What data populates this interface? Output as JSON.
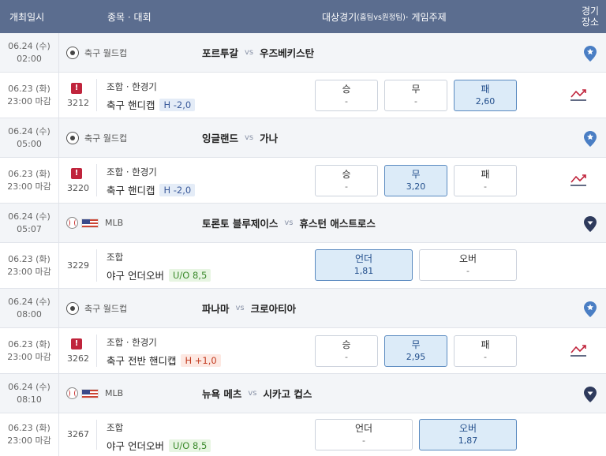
{
  "header": {
    "date": "개최일시",
    "game": "종목 · 대회",
    "match_main": "대상경기",
    "match_sub": "(홈팀vs원정팀)",
    "match_tail": " · 게임주제",
    "place_1": "경기",
    "place_2": "장소"
  },
  "vs": "vs",
  "colors": {
    "header_bg": "#5b6d8f",
    "selected": "#dcebf8",
    "warning": "#c0243c",
    "pin_blue": "#4a7ec4",
    "pin_dark": "#2e3a5c"
  },
  "games": [
    {
      "date": "06.24 (수)",
      "time": "02:00",
      "league": "축구 월드컵",
      "sport_icon": "soccer-ball-icon",
      "home": "포르투갈",
      "away": "우즈베키스탄",
      "pin": "blue"
    },
    {
      "date": "06.24 (수)",
      "time": "05:00",
      "league": "축구 월드컵",
      "sport_icon": "soccer-ball-icon",
      "home": "잉글랜드",
      "away": "가나",
      "pin": "blue"
    },
    {
      "date": "06.24 (수)",
      "time": "05:07",
      "league": "MLB",
      "sport_icon": "baseball-icon",
      "home": "토론토 블루제이스",
      "away": "휴스턴 애스트로스",
      "pin": "dark"
    },
    {
      "date": "06.24 (수)",
      "time": "08:00",
      "league": "축구 월드컵",
      "sport_icon": "soccer-ball-icon",
      "home": "파나마",
      "away": "크로아티아",
      "pin": "blue"
    },
    {
      "date": "06.24 (수)",
      "time": "08:10",
      "league": "MLB",
      "sport_icon": "baseball-icon",
      "home": "뉴욕 메츠",
      "away": "시카고 컵스",
      "pin": "dark"
    }
  ],
  "bets": [
    {
      "date": "06.23 (화)",
      "deadline": "23:00 마감",
      "warn": "!",
      "number": "3212",
      "type": "조합 · 한경기",
      "name": "축구 핸디캡",
      "handicap": "H -2,0",
      "odds": [
        {
          "label": "승",
          "value": "-"
        },
        {
          "label": "무",
          "value": "-"
        },
        {
          "label": "패",
          "value": "2,60"
        }
      ]
    },
    {
      "date": "06.23 (화)",
      "deadline": "23:00 마감",
      "warn": "!",
      "number": "3220",
      "type": "조합 · 한경기",
      "name": "축구 핸디캡",
      "handicap": "H -2,0",
      "odds": [
        {
          "label": "승",
          "value": "-"
        },
        {
          "label": "무",
          "value": "3,20"
        },
        {
          "label": "패",
          "value": "-"
        }
      ]
    },
    {
      "date": "06.23 (화)",
      "deadline": "23:00 마감",
      "number": "3229",
      "type": "조합",
      "name": "야구 언더오버",
      "handicap": "U/O 8,5",
      "odds": [
        {
          "label": "언더",
          "value": "1,81"
        },
        {
          "label": "오버",
          "value": "-"
        }
      ]
    },
    {
      "date": "06.23 (화)",
      "deadline": "23:00 마감",
      "warn": "!",
      "number": "3262",
      "type": "조합 · 한경기",
      "name": "축구 전반 핸디캡",
      "handicap": "H +1,0",
      "odds": [
        {
          "label": "승",
          "value": "-"
        },
        {
          "label": "무",
          "value": "2,95"
        },
        {
          "label": "패",
          "value": "-"
        }
      ]
    },
    {
      "date": "06.23 (화)",
      "deadline": "23:00 마감",
      "number": "3267",
      "type": "조합",
      "name": "야구 언더오버",
      "handicap": "U/O 8,5",
      "odds": [
        {
          "label": "언더",
          "value": "-"
        },
        {
          "label": "오버",
          "value": "1,87"
        }
      ]
    }
  ]
}
